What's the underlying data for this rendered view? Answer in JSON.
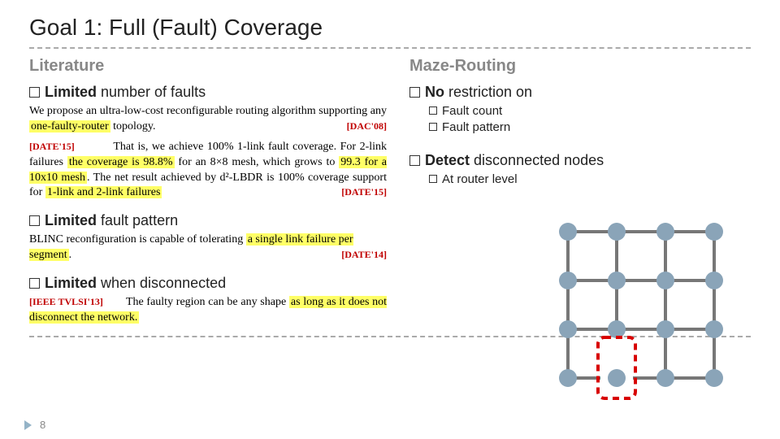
{
  "title": "Goal 1: Full (Fault) Coverage",
  "left": {
    "heading": "Literature",
    "bullet1_a": "Limited",
    "bullet1_b": " number of faults",
    "para1_pre": "We propose an ultra-low-cost reconfigurable routing algorithm supporting any ",
    "para1_hl": "one-faulty-router",
    "para1_post": " topology.",
    "cite1": "[DAC'08]",
    "para2_pre": "                       That is, we achieve 100% 1-link fault coverage. For 2-link failures ",
    "para2_hl": "the coverage is 98.8%",
    "para2_mid": " for an 8×8 mesh, which grows to ",
    "para2_hl2": "99.3 for a 10x10 mesh",
    "para2_post": ". The net result achieved by d²-LBDR is 100% coverage support for ",
    "para2_hl3": "1-link and 2-link failures",
    "cite2a": "[DATE'15]",
    "cite2b": "[DATE'15]",
    "bullet2_a": "Limited",
    "bullet2_b": " fault pattern",
    "para3_pre": "BLINC reconfiguration is capable of tolerating ",
    "para3_hl": "a single link failure per segment",
    "para3_post": ".",
    "cite3": "[DATE'14]",
    "bullet3_a": "Limited",
    "bullet3_b": " when disconnected",
    "para4_pre": "                                The faulty region can be any shape ",
    "para4_hl": "as long as it does not disconnect the network.",
    "cite4": "[IEEE TVLSI'13]"
  },
  "right": {
    "heading": "Maze-Routing",
    "bullet1_a": "No",
    "bullet1_b": " restriction on",
    "sub1": "Fault count",
    "sub2": "Fault pattern",
    "bullet2_a": "Detect",
    "bullet2_b": " disconnected nodes",
    "sub3": "At router level"
  },
  "page_number": "8"
}
